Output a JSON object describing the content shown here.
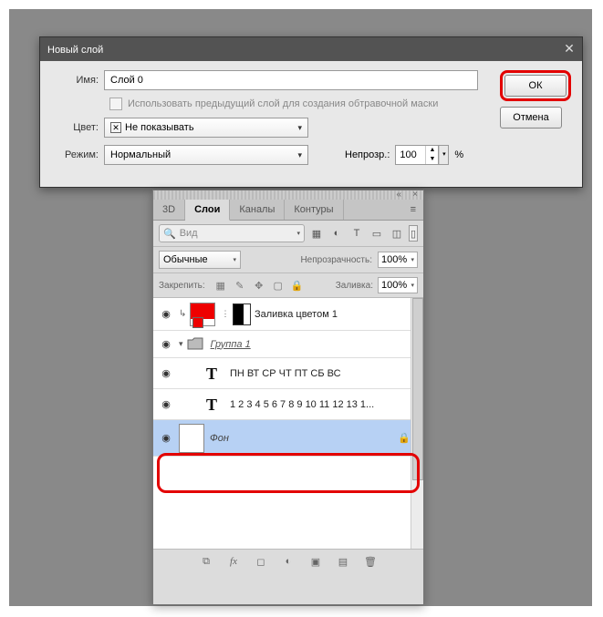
{
  "dialog": {
    "title": "Новый слой",
    "name_label": "Имя:",
    "name_value": "Слой 0",
    "clip_text": "Использовать предыдущий слой для создания обтравочной маски",
    "color_label": "Цвет:",
    "color_value": "Не показывать",
    "mode_label": "Режим:",
    "mode_value": "Нормальный",
    "opacity_label": "Непрозр.:",
    "opacity_value": "100",
    "percent": "%",
    "ok": "ОК",
    "cancel": "Отмена"
  },
  "panel": {
    "tabs": [
      "3D",
      "Слои",
      "Каналы",
      "Контуры"
    ],
    "active_tab": 1,
    "search_placeholder": "Вид",
    "blend_mode": "Обычные",
    "opacity_label": "Непрозрачность:",
    "opacity_value": "100%",
    "lock_label": "Закрепить:",
    "fill_label": "Заливка:",
    "fill_value": "100%",
    "layers": [
      {
        "name": "Заливка цветом 1"
      },
      {
        "name": "Группа 1"
      },
      {
        "name": "ПН ВТ СР ЧТ ПТ СБ ВС"
      },
      {
        "name": "1 2 3 4 5 6 7 8 9 10 11 12 13 1..."
      },
      {
        "name": "Фон"
      }
    ]
  }
}
